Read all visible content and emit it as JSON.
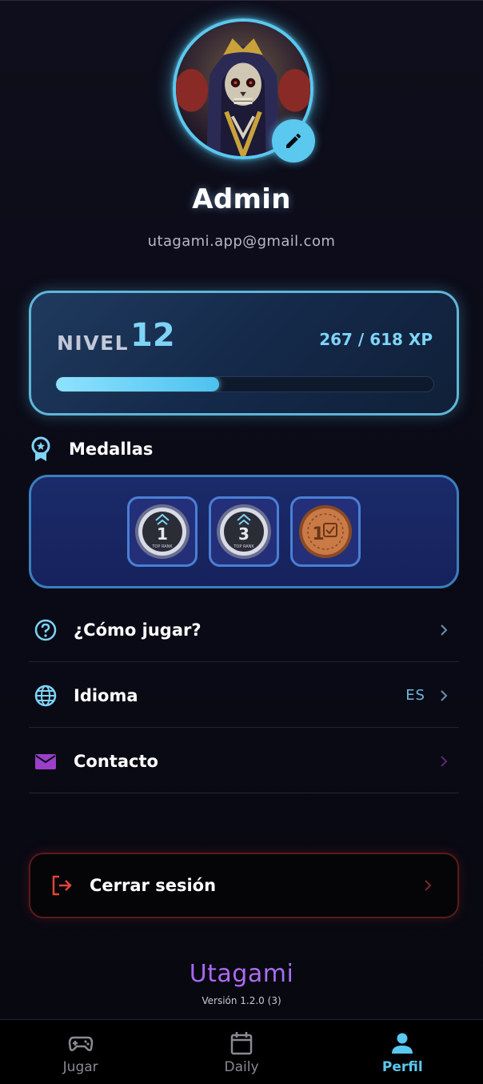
{
  "profile": {
    "name": "Admin",
    "email": "utagami.app@gmail.com"
  },
  "level": {
    "label": "NIVEL",
    "value": "12",
    "xp_text": "267 / 618 XP",
    "xp_current": 267,
    "xp_total": 618
  },
  "medals": {
    "title": "Medallas",
    "items": [
      {
        "name": "top-rank-1-medal",
        "number": "1",
        "caption": "TOP RANK"
      },
      {
        "name": "top-rank-3-medal",
        "number": "3",
        "caption": "TOP RANK"
      },
      {
        "name": "daily-1-bronze-medal",
        "number": "1"
      }
    ]
  },
  "menu": {
    "how_to_play": "¿Cómo jugar?",
    "language": "Idioma",
    "language_value": "ES",
    "contact": "Contacto"
  },
  "logout": {
    "label": "Cerrar sesión"
  },
  "brand": {
    "name": "Utagami",
    "version": "Versión 1.2.0 (3)"
  },
  "nav": {
    "tabs": [
      {
        "label": "Jugar",
        "icon": "gamepad-icon",
        "active": false
      },
      {
        "label": "Daily",
        "icon": "calendar-icon",
        "active": false
      },
      {
        "label": "Perfil",
        "icon": "person-icon",
        "active": true
      }
    ]
  },
  "colors": {
    "accent": "#5ac8ef",
    "logout": "#e0453a",
    "contact_icon": "#9b3fc9"
  }
}
